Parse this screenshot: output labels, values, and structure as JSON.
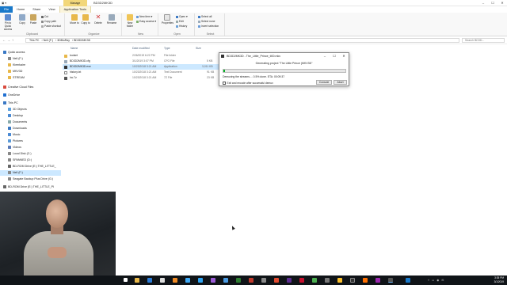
{
  "window": {
    "title": "BD3D2MK3D",
    "manage_tab": "Manage",
    "controls": [
      "–",
      "☐",
      "✕"
    ]
  },
  "ribbon_tabs": [
    {
      "label": "File"
    },
    {
      "label": "Home"
    },
    {
      "label": "Share"
    },
    {
      "label": "View"
    },
    {
      "label": "Application Tools"
    }
  ],
  "ribbon": {
    "clipboard": {
      "group_label": "Clipboard",
      "pin": "Pin to Quick access",
      "copy": "Copy",
      "paste": "Paste",
      "cut": "Cut",
      "copy_path": "Copy path",
      "paste_shortcut": "Paste shortcut"
    },
    "organize": {
      "group_label": "Organize",
      "move_to": "Move to",
      "copy_to": "Copy to",
      "delete": "Delete",
      "rename": "Rename"
    },
    "new": {
      "group_label": "New",
      "new_folder": "New folder",
      "new_item": "New item",
      "easy_access": "Easy access"
    },
    "open": {
      "group_label": "Open",
      "properties": "Properties",
      "open": "Open",
      "edit": "Edit",
      "history": "History"
    },
    "select": {
      "group_label": "Select",
      "select_all": "Select all",
      "select_none": "Select none",
      "invert_selection": "Invert selection"
    }
  },
  "address": {
    "crumbs": [
      "This PC",
      "Nell (F:)",
      "3DBluRay",
      "BD3D2MK3D"
    ],
    "search_placeholder": "Search BD3D..."
  },
  "nav_pane": {
    "items": [
      {
        "label": "Quick access"
      },
      {
        "label": "Nell (F:)"
      },
      {
        "label": "Kleerkaire"
      },
      {
        "label": "MKV3D"
      },
      {
        "label": "STREAM"
      },
      {
        "label": "Creative Cloud Files"
      },
      {
        "label": "OneDrive"
      },
      {
        "label": "This PC"
      },
      {
        "label": "3D Objects"
      },
      {
        "label": "Desktop"
      },
      {
        "label": "Documents"
      },
      {
        "label": "Downloads"
      },
      {
        "label": "Music"
      },
      {
        "label": "Pictures"
      },
      {
        "label": "Videos"
      },
      {
        "label": "Local Disk (C:)"
      },
      {
        "label": "SPANNED (D:)"
      },
      {
        "label": "BD-ROM Drive (E:) THE_LITTLE_"
      },
      {
        "label": "Nell (F:)"
      },
      {
        "label": "Seagate Backup Plus Drive (G:)"
      },
      {
        "label": "BD-ROM Drive (E:) THE_LITTLE_PI"
      }
    ]
  },
  "file_list": {
    "columns": {
      "name": "Name",
      "date": "Date modified",
      "type": "Type",
      "size": "Size"
    },
    "rows": [
      {
        "name": "toolset",
        "date": "2/26/2019 6:22 PM",
        "type": "File folder",
        "size": "",
        "icon": "folder-icon"
      },
      {
        "name": "BD3D2MK3D.cfg",
        "date": "3/1/2019 3:07 PM",
        "type": "CFG File",
        "size": "5 KB",
        "icon": "file-icon"
      },
      {
        "name": "BD3D2MK3D.exe",
        "date": "10/23/2018 3:21 AM",
        "type": "Application",
        "size": "3,011 KB",
        "icon": "app-icon"
      },
      {
        "name": "history.txt",
        "date": "10/23/2018 3:21 AM",
        "type": "Text Document",
        "size": "91 KB",
        "icon": "file-icon"
      },
      {
        "name": "lnc.7z",
        "date": "10/23/2018 3:21 AM",
        "type": "7Z File",
        "size": "23 KB",
        "icon": "archive-icon"
      }
    ]
  },
  "dialog": {
    "title": "BD3D2MK3D - The_Little_Prince_ti00.mkv",
    "generating_text": "Generating project \"The Little Prince (MKV3D\"",
    "progress_percent": 0.5,
    "status": "Demuxing the streams....  0.5% done.  ETA: 00:09:37",
    "checkbox_label": "Exit and encode after successful demux",
    "console_label": "Console",
    "abort_label": "Abort",
    "controls": [
      "–",
      "☐",
      "✕"
    ]
  },
  "taskbar": {
    "time": "3:35 PM",
    "date": "3/1/2019",
    "icons": [
      "start-icon",
      "search-icon",
      "task-view-icon",
      "explorer-icon",
      "edge-icon",
      "store-icon",
      "vlc-icon",
      "photoshop-icon",
      "premiere-icon",
      "chrome-icon",
      "firefox-icon",
      "settings-icon",
      "mail-icon",
      "app-icon"
    ]
  },
  "colors": {
    "file_tab": "#1979ca",
    "manage_tab": "#f2d77a",
    "selection": "#cce8ff",
    "progress": "#06b025",
    "taskbar": "#101418"
  }
}
